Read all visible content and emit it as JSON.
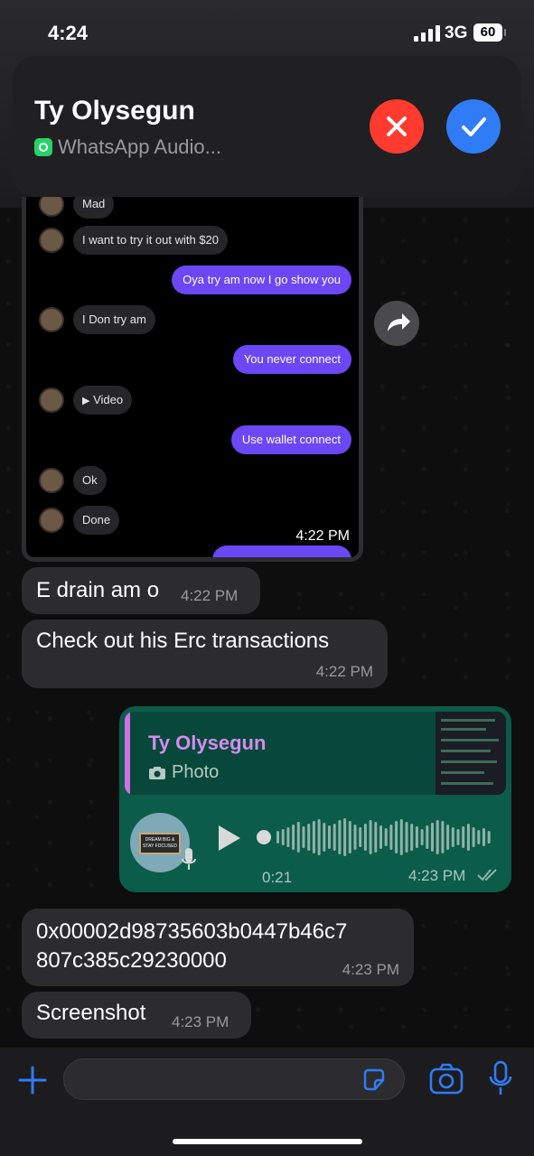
{
  "status": {
    "time": "4:24",
    "network": "3G",
    "battery": "60"
  },
  "banner": {
    "name": "Ty Olysegun",
    "subtitle": "WhatsApp Audio...",
    "decline_icon": "close-icon",
    "accept_icon": "checkmark-icon"
  },
  "screenshot": {
    "messages": [
      {
        "side": "in",
        "text": "Mad"
      },
      {
        "side": "in",
        "text": "I want to try it out with $20"
      },
      {
        "side": "out",
        "text": "Oya try am now I go show you"
      },
      {
        "side": "in",
        "text": "I Don try am"
      },
      {
        "side": "out",
        "text": "You never connect"
      },
      {
        "side": "in",
        "text": "Video"
      },
      {
        "side": "out",
        "text": "Use wallet connect"
      },
      {
        "side": "in",
        "text": "Ok"
      },
      {
        "side": "in",
        "text": "Done"
      }
    ],
    "time": "4:22 PM"
  },
  "chat": {
    "m1": {
      "text": "E drain am o",
      "time": "4:22 PM"
    },
    "m2": {
      "text": "Check out his Erc transactions",
      "time": "4:22 PM"
    },
    "voice": {
      "reply_name": "Ty Olysegun",
      "reply_type": "Photo",
      "duration": "0:21",
      "time": "4:23 PM",
      "avatar_text": "DREAM BIG & STAY FOCUSED"
    },
    "m3": {
      "text_line1": "0x00002d98735603b0447b46c7",
      "text_line2": "807c385c29230000",
      "time": "4:23 PM"
    },
    "m4": {
      "text": "Screenshot",
      "time": "4:23 PM"
    }
  },
  "colors": {
    "outgoing": "#0c5c4a",
    "incoming": "#2c2c2e",
    "accent": "#2f7cf6",
    "decline": "#ff3b30",
    "reply_name": "#d38cf0"
  },
  "waveform": [
    14,
    18,
    22,
    28,
    34,
    24,
    30,
    36,
    40,
    32,
    26,
    30,
    38,
    42,
    36,
    28,
    22,
    30,
    38,
    34,
    26,
    20,
    28,
    36,
    40,
    34,
    30,
    24,
    18,
    26,
    32,
    38,
    36,
    28,
    22,
    18,
    24,
    30,
    22,
    16,
    20,
    14
  ]
}
